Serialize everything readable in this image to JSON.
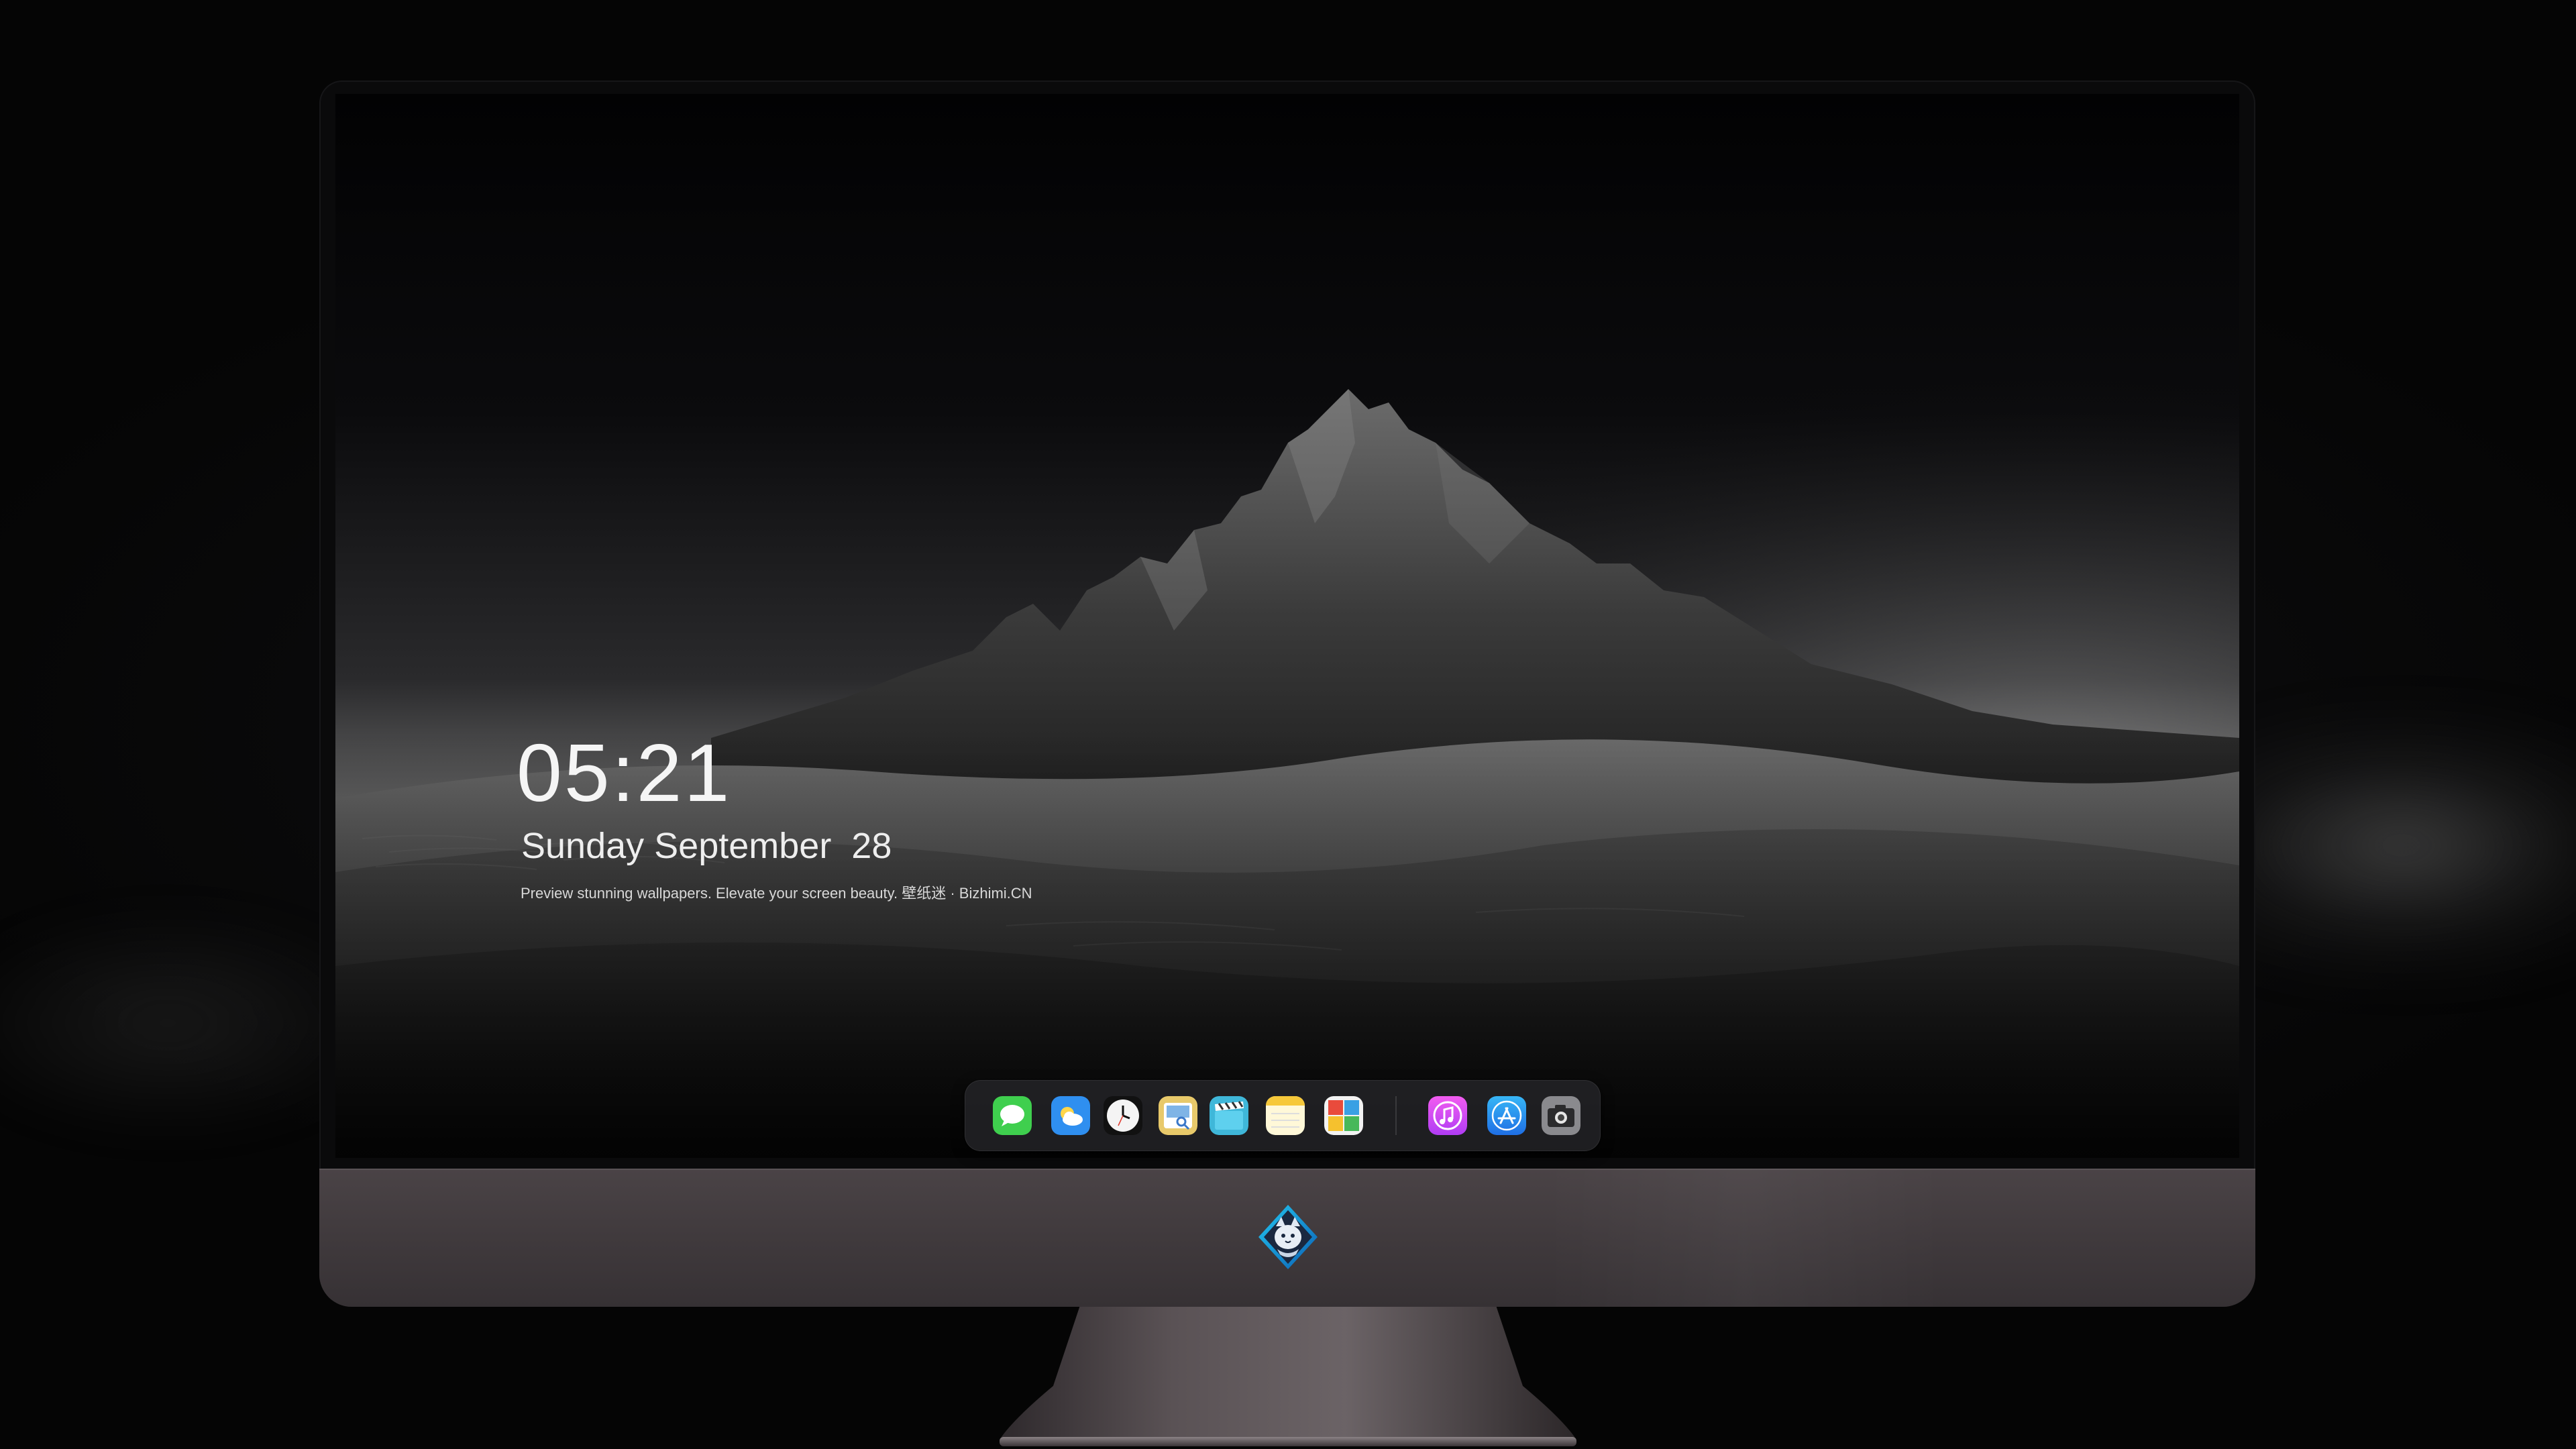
{
  "lock_screen": {
    "time": "05:21",
    "date": "Sunday September  28",
    "caption": "Preview stunning wallpapers. Elevate your screen beauty. 壁纸迷 · Bizhimi.CN"
  },
  "dock": {
    "apps": [
      {
        "name": "Messages",
        "icon": "messages-icon"
      },
      {
        "name": "Weather",
        "icon": "weather-icon"
      },
      {
        "name": "Clock",
        "icon": "clock-icon"
      },
      {
        "name": "Preview",
        "icon": "preview-icon"
      },
      {
        "name": "Clips",
        "icon": "clapperboard-icon"
      },
      {
        "name": "Notes",
        "icon": "notes-icon"
      },
      {
        "name": "Photo Booth",
        "icon": "photo-booth-icon"
      },
      {
        "name": "iTunes",
        "icon": "music-icon"
      },
      {
        "name": "App Store",
        "icon": "app-store-icon"
      },
      {
        "name": "Camera",
        "icon": "camera-icon"
      }
    ]
  },
  "device": {
    "logo": "fox-badge-logo"
  },
  "colors": {
    "chin": "#433c3f",
    "dock_background": "#28282c",
    "text": "#f5f5f5"
  }
}
